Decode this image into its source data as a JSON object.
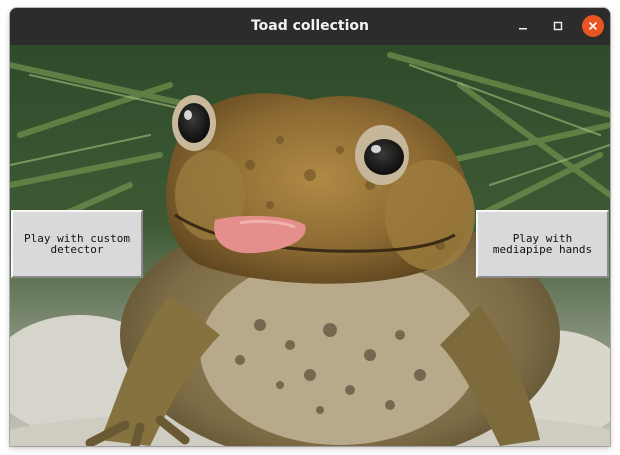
{
  "window": {
    "title": "Toad collection",
    "controls": {
      "minimize_icon": "minimize-icon",
      "maximize_icon": "maximize-icon",
      "close_icon": "close-icon"
    },
    "accent_color": "#e95420",
    "titlebar_color": "#2c2c2c"
  },
  "scene": {
    "image": "toad photograph"
  },
  "buttons": {
    "left_label": "Play with custom\ndetector",
    "right_label": "Play with\nmediapipe hands"
  }
}
